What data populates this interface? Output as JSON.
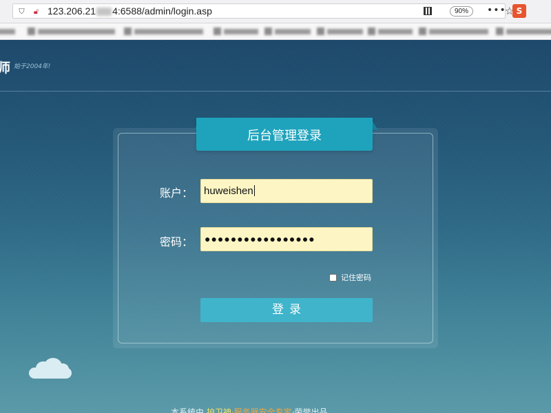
{
  "browser": {
    "url_prefix": "123.206.21",
    "url_suffix": "4:6588/admin/login.asp",
    "zoom": "90%"
  },
  "header": {
    "brand_fragment": "师",
    "since": "始于2004年!"
  },
  "login": {
    "title": "后台管理登录",
    "account_label": "账户：",
    "account_value": "huweishen",
    "password_label": "密码：",
    "password_mask": "●●●●●●●●●●●●●●●●●",
    "remember_label": "记住密码",
    "remember_checked": false,
    "submit_label": "登录"
  },
  "footer": {
    "pre": "本系统由",
    "brand": "护卫神",
    "product": "·服务器安全专家",
    "post": "·荣誉出品"
  },
  "colors": {
    "ribbon": "#1fa3bd",
    "button": "#3fb4cb",
    "input_bg": "#fdf6c4",
    "page_top": "#1d486b",
    "page_bottom": "#5a9aa8"
  }
}
